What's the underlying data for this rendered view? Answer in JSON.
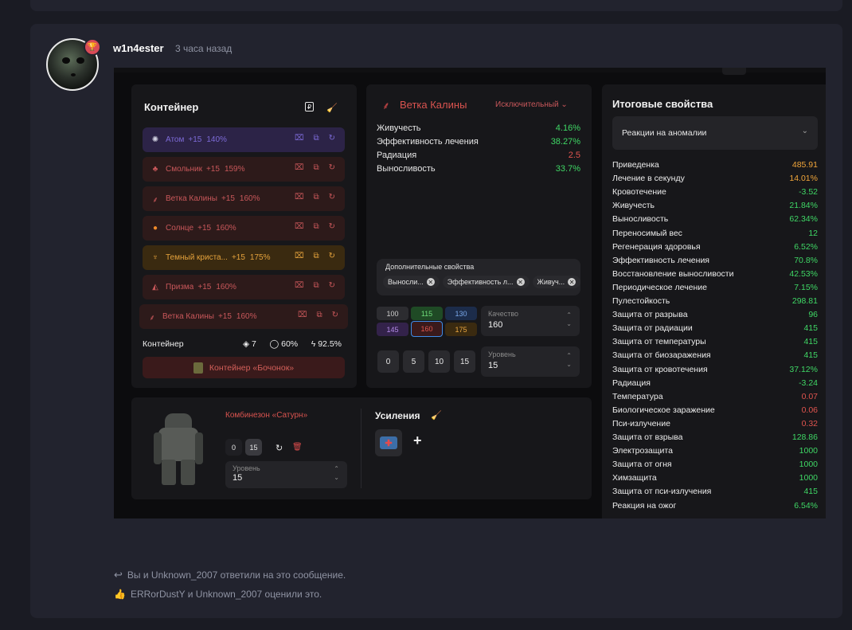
{
  "post": {
    "username": "w1n4ester",
    "time": "3 часа назад",
    "replied_text": "Вы и Unknown_2007 ответили на это сообщение.",
    "liked_text": "ERRorDustY и Unknown_2007 оценили это."
  },
  "container": {
    "title": "Контейнер",
    "artifacts": [
      {
        "name": "Атом",
        "level": "+15",
        "percent": "140%",
        "color": "#7c6ad6",
        "bg": "#2c2347",
        "icon": "atom-icon"
      },
      {
        "name": "Смольник",
        "level": "+15",
        "percent": "159%",
        "color": "#c8575a",
        "bg": "#2d1a1a",
        "icon": "leaf-icon"
      },
      {
        "name": "Ветка Калины",
        "level": "+15",
        "percent": "160%",
        "color": "#c8575a",
        "bg": "#2d1a1a",
        "icon": "branch-icon"
      },
      {
        "name": "Солнце",
        "level": "+15",
        "percent": "160%",
        "color": "#c8575a",
        "bg": "#2d1a1a",
        "icon": "sun-icon"
      },
      {
        "name": "Темный криста...",
        "level": "+15",
        "percent": "175%",
        "color": "#e4a23c",
        "bg": "#3a2a10",
        "icon": "crystal-icon"
      },
      {
        "name": "Призма",
        "level": "+15",
        "percent": "160%",
        "color": "#c8575a",
        "bg": "#2d1a1a",
        "icon": "prism-icon"
      },
      {
        "name": "Ветка Калины",
        "level": "+15",
        "percent": "160%",
        "color": "#c8575a",
        "bg": "#2d1a1a",
        "icon": "branch-icon"
      }
    ],
    "footer_label": "Контейнер",
    "footer_slots": "7",
    "footer_protection": "60%",
    "footer_efficiency": "92.5%",
    "container_button": "Контейнер «Бочонок»"
  },
  "artifact_detail": {
    "name": "Ветка Калины",
    "rarity": "Исключительный",
    "stats": [
      {
        "label": "Живучесть",
        "value": "4.16%",
        "tone": "green"
      },
      {
        "label": "Эффективность лечения",
        "value": "38.27%",
        "tone": "green"
      },
      {
        "label": "Радиация",
        "value": "2.5",
        "tone": "red"
      },
      {
        "label": "Выносливость",
        "value": "33.7%",
        "tone": "green"
      }
    ],
    "extra_title": "Дополнительные свойства",
    "extra_chips": [
      "Выносли...",
      "Эффективность л...",
      "Живуч..."
    ],
    "quality_boxes": [
      "100",
      "115",
      "130",
      "145",
      "160",
      "175"
    ],
    "quality_label": "Качество",
    "quality_value": "160",
    "level_buttons": [
      "0",
      "5",
      "10",
      "15"
    ],
    "level_label": "Уровень",
    "level_value": "15"
  },
  "armor": {
    "name": "Комбинезон «Сатурн»",
    "level_buttons": [
      "0",
      "15"
    ],
    "level_label": "Уровень",
    "level_value": "15",
    "boosts_title": "Усиления",
    "add_label": "+"
  },
  "totals": {
    "title": "Итоговые свойства",
    "dropdown": "Реакции на аномалии",
    "rows": [
      {
        "label": "Приведенка",
        "value": "485.91",
        "tone": "orange"
      },
      {
        "label": "Лечение в секунду",
        "value": "14.01%",
        "tone": "orange"
      },
      {
        "label": "Кровотечение",
        "value": "-3.52",
        "tone": "green"
      },
      {
        "label": "Живучесть",
        "value": "21.84%",
        "tone": "green"
      },
      {
        "label": "Выносливость",
        "value": "62.34%",
        "tone": "green"
      },
      {
        "label": "Переносимый вес",
        "value": "12",
        "tone": "green"
      },
      {
        "label": "Регенерация здоровья",
        "value": "6.52%",
        "tone": "green"
      },
      {
        "label": "Эффективность лечения",
        "value": "70.8%",
        "tone": "green"
      },
      {
        "label": "Восстановление выносливости",
        "value": "42.53%",
        "tone": "green"
      },
      {
        "label": "Периодическое лечение",
        "value": "7.15%",
        "tone": "green"
      },
      {
        "label": "Пулестойкость",
        "value": "298.81",
        "tone": "green"
      },
      {
        "label": "Защита от разрыва",
        "value": "96",
        "tone": "green"
      },
      {
        "label": "Защита от радиации",
        "value": "415",
        "tone": "green"
      },
      {
        "label": "Защита от температуры",
        "value": "415",
        "tone": "green"
      },
      {
        "label": "Защита от биозаражения",
        "value": "415",
        "tone": "green"
      },
      {
        "label": "Защита от кровотечения",
        "value": "37.12%",
        "tone": "green"
      },
      {
        "label": "Радиация",
        "value": "-3.24",
        "tone": "green"
      },
      {
        "label": "Температура",
        "value": "0.07",
        "tone": "red"
      },
      {
        "label": "Биологическое заражение",
        "value": "0.06",
        "tone": "red"
      },
      {
        "label": "Пси-излучение",
        "value": "0.32",
        "tone": "red"
      },
      {
        "label": "Защита от взрыва",
        "value": "128.86",
        "tone": "green"
      },
      {
        "label": "Электрозащита",
        "value": "1000",
        "tone": "green"
      },
      {
        "label": "Защита от огня",
        "value": "1000",
        "tone": "green"
      },
      {
        "label": "Химзащита",
        "value": "1000",
        "tone": "green"
      },
      {
        "label": "Защита от пси-излучения",
        "value": "415",
        "tone": "green"
      },
      {
        "label": "Реакция на ожог",
        "value": "6.54%",
        "tone": "green"
      }
    ]
  }
}
